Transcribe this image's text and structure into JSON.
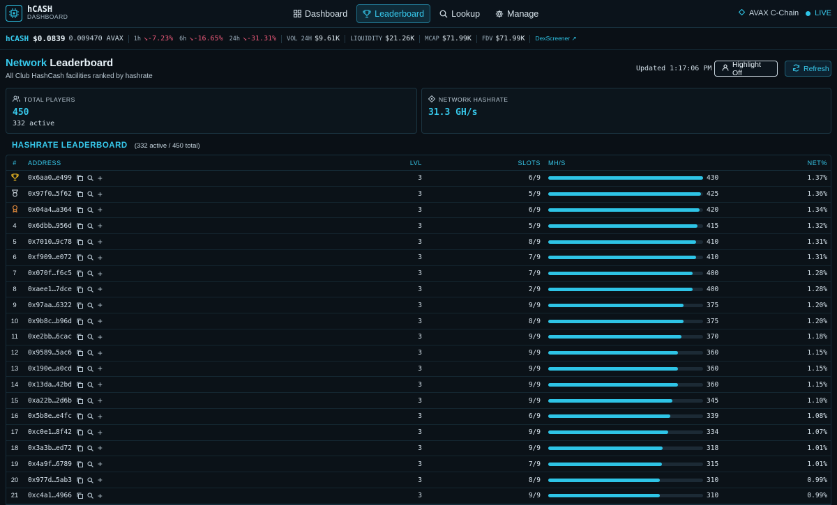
{
  "app": {
    "title": "hCASH",
    "subtitle": "DASHBOARD"
  },
  "nav": {
    "tabs": [
      {
        "label": "Dashboard",
        "icon": "grid-icon"
      },
      {
        "label": "Leaderboard",
        "icon": "trophy-icon",
        "active": true
      },
      {
        "label": "Lookup",
        "icon": "search-icon"
      },
      {
        "label": "Manage",
        "icon": "gear-icon"
      }
    ],
    "chain": "AVAX C-Chain",
    "live": "LIVE"
  },
  "ticker": {
    "symbol": "hCASH",
    "price": "$0.0839",
    "price_avax": "0.009470 AVAX",
    "change_1h_label": "1h",
    "change_1h": "-7.23%",
    "change_6h_label": "6h",
    "change_6h": "-16.65%",
    "change_24h_label": "24h",
    "change_24h": "-31.31%",
    "vol_label": "VOL 24H",
    "vol": "$9.61K",
    "liq_label": "LIQUIDITY",
    "liq": "$21.26K",
    "mcap_label": "MCAP",
    "mcap": "$71.99K",
    "fdv_label": "FDV",
    "fdv": "$71.99K",
    "link": "DexScreener ↗"
  },
  "page": {
    "title_accent": "Network",
    "title_rest": "Leaderboard",
    "subtitle": "All Club HashCash facilities ranked by hashrate",
    "updated": "Updated 1:17:06 PM",
    "highlight_btn": "Highlight Off",
    "refresh_btn": "Refresh"
  },
  "stats": {
    "players_label": "TOTAL PLAYERS",
    "players_value": "450",
    "players_sub": "332 active",
    "hashrate_label": "NETWORK HASHRATE",
    "hashrate_value": "31.3 GH/s"
  },
  "leaderboard": {
    "title": "HASHRATE LEADERBOARD",
    "count": "(332 active / 450 total)",
    "columns": {
      "rank": "#",
      "address": "ADDRESS",
      "lvl": "LVL",
      "slots": "SLOTS",
      "mhs": "MH/S",
      "net": "NET%"
    },
    "max_mhs": 430,
    "rows": [
      {
        "rank": "1",
        "medal": "gold",
        "address": "0x6aa0…e499",
        "lvl": "3",
        "slots": "6/9",
        "mhs": "430",
        "net": "1.37%"
      },
      {
        "rank": "2",
        "medal": "silver",
        "address": "0x97f0…5f62",
        "lvl": "3",
        "slots": "5/9",
        "mhs": "425",
        "net": "1.36%"
      },
      {
        "rank": "3",
        "medal": "bronze",
        "address": "0x04a4…a364",
        "lvl": "3",
        "slots": "6/9",
        "mhs": "420",
        "net": "1.34%"
      },
      {
        "rank": "4",
        "address": "0x6dbb…956d",
        "lvl": "3",
        "slots": "5/9",
        "mhs": "415",
        "net": "1.32%"
      },
      {
        "rank": "5",
        "address": "0x7010…9c78",
        "lvl": "3",
        "slots": "8/9",
        "mhs": "410",
        "net": "1.31%"
      },
      {
        "rank": "6",
        "address": "0xf909…e072",
        "lvl": "3",
        "slots": "7/9",
        "mhs": "410",
        "net": "1.31%"
      },
      {
        "rank": "7",
        "address": "0x070f…f6c5",
        "lvl": "3",
        "slots": "7/9",
        "mhs": "400",
        "net": "1.28%"
      },
      {
        "rank": "8",
        "address": "0xaee1…7dce",
        "lvl": "3",
        "slots": "2/9",
        "mhs": "400",
        "net": "1.28%"
      },
      {
        "rank": "9",
        "address": "0x97aa…6322",
        "lvl": "3",
        "slots": "9/9",
        "mhs": "375",
        "net": "1.20%"
      },
      {
        "rank": "10",
        "address": "0x9b8c…b96d",
        "lvl": "3",
        "slots": "8/9",
        "mhs": "375",
        "net": "1.20%"
      },
      {
        "rank": "11",
        "address": "0xe2bb…6cac",
        "lvl": "3",
        "slots": "9/9",
        "mhs": "370",
        "net": "1.18%"
      },
      {
        "rank": "12",
        "address": "0x9589…5ac6",
        "lvl": "3",
        "slots": "9/9",
        "mhs": "360",
        "net": "1.15%"
      },
      {
        "rank": "13",
        "address": "0x190e…a0cd",
        "lvl": "3",
        "slots": "9/9",
        "mhs": "360",
        "net": "1.15%"
      },
      {
        "rank": "14",
        "address": "0x13da…42bd",
        "lvl": "3",
        "slots": "9/9",
        "mhs": "360",
        "net": "1.15%"
      },
      {
        "rank": "15",
        "address": "0xa22b…2d6b",
        "lvl": "3",
        "slots": "9/9",
        "mhs": "345",
        "net": "1.10%"
      },
      {
        "rank": "16",
        "address": "0x5b8e…e4fc",
        "lvl": "3",
        "slots": "6/9",
        "mhs": "339",
        "net": "1.08%"
      },
      {
        "rank": "17",
        "address": "0xc0e1…8f42",
        "lvl": "3",
        "slots": "9/9",
        "mhs": "334",
        "net": "1.07%"
      },
      {
        "rank": "18",
        "address": "0x3a3b…ed72",
        "lvl": "3",
        "slots": "9/9",
        "mhs": "318",
        "net": "1.01%"
      },
      {
        "rank": "19",
        "address": "0x4a9f…6789",
        "lvl": "3",
        "slots": "7/9",
        "mhs": "315",
        "net": "1.01%"
      },
      {
        "rank": "20",
        "address": "0x977d…5ab3",
        "lvl": "3",
        "slots": "8/9",
        "mhs": "310",
        "net": "0.99%"
      },
      {
        "rank": "21",
        "address": "0xc4a1…4966",
        "lvl": "3",
        "slots": "9/9",
        "mhs": "310",
        "net": "0.99%"
      }
    ]
  },
  "colors": {
    "accent": "#2ec4e6",
    "negative": "#ee5a7a",
    "gold": "#e6b422",
    "silver": "#c9d3da",
    "bronze": "#e08a3c"
  }
}
